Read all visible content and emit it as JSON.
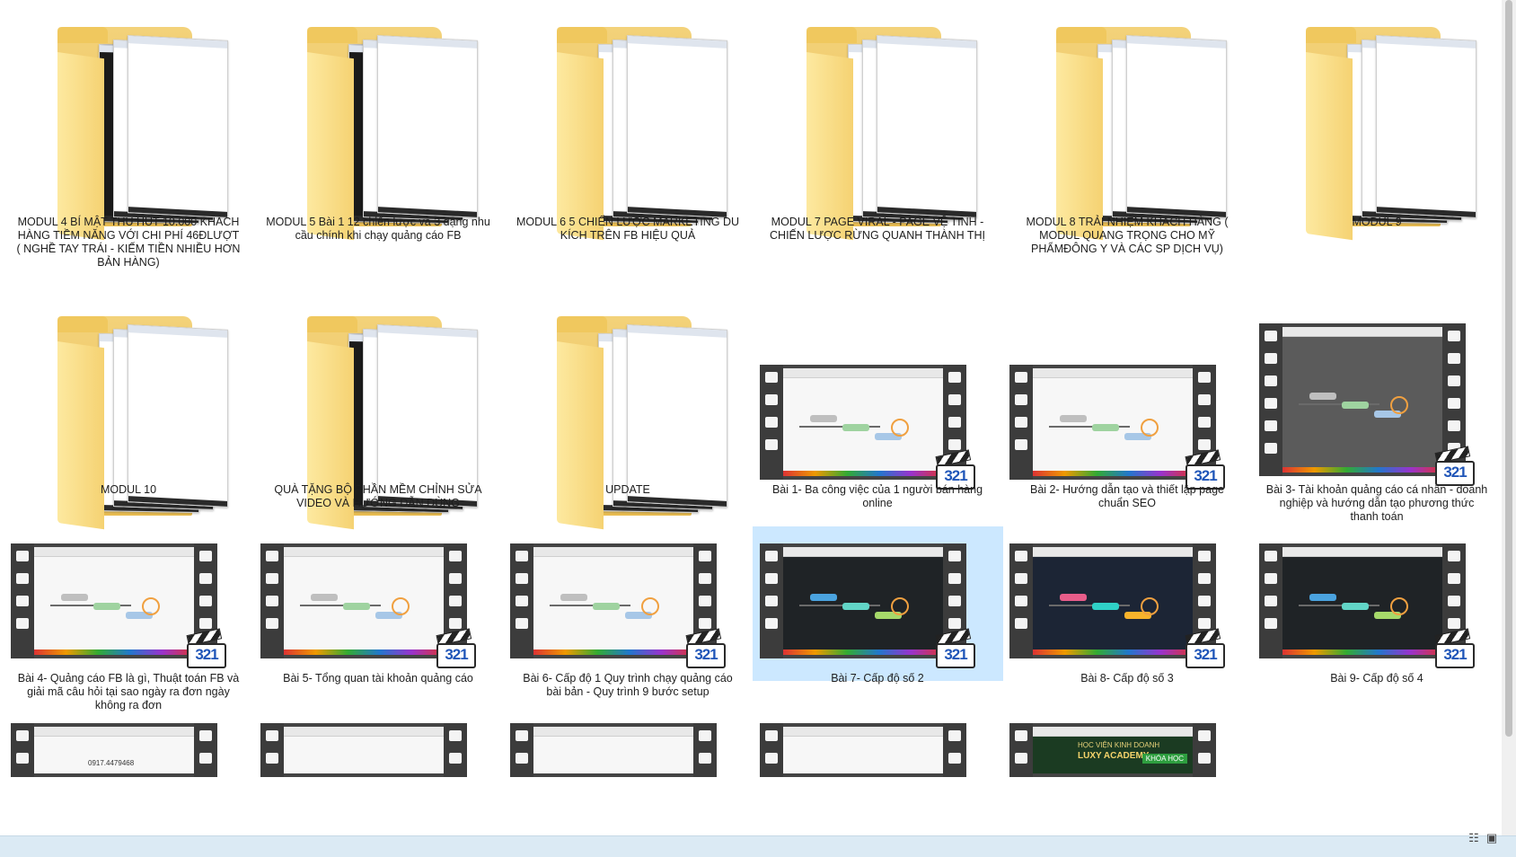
{
  "items": [
    {
      "kind": "folder",
      "label": "MODUL 4 BÍ MẬT THU HÚT 10.000 KHÁCH HÀNG TIỀM NĂNG VỚI CHI PHÍ 46ĐLƯỢT ( NGHỀ TAY TRÁI - KIẾM TIỀN NHIỀU HƠN BẢN HÀNG)",
      "style": "dark"
    },
    {
      "kind": "folder",
      "label": "MODUL 5 Bài 1 12 chiến lược và 3 dạng nhu cầu chính khi chạy quảng cáo FB",
      "style": "dark"
    },
    {
      "kind": "folder",
      "label": "MODUL 6 5 CHIẾN LƯỢC MARKETING DU KÍCH TRÊN FB HIỆU QUẢ",
      "style": "light"
    },
    {
      "kind": "folder",
      "label": "MODUL 7 PAGE VIRAL - PAGE VỆ TINH - CHIẾN LƯỢC RỪNG QUANH THÀNH THỊ",
      "style": "light"
    },
    {
      "kind": "folder",
      "label": "MODUL 8 TRẢI NHIỆM KHÁCH HÀNG ( MODUL QUANG TRỌNG CHO MỸ PHẨMĐÔNG Y VÀ CÁC SP DỊCH VỤ)",
      "style": "light"
    },
    {
      "kind": "folder",
      "label": "MODUL 9",
      "style": "light"
    },
    {
      "kind": "folder",
      "label": "MODUL 10",
      "style": "light"
    },
    {
      "kind": "folder",
      "label": "QUÀ TẶNG BỘ PHẦN MỀM CHỈNH SỬA VIDEO VÀ HƯỚNG DẪN DÙNG",
      "style": "dark"
    },
    {
      "kind": "folder",
      "label": "UPDATE",
      "style": "light"
    },
    {
      "kind": "video",
      "label": "Bài 1- Ba công việc của 1 người bán hàng online",
      "screen": "light"
    },
    {
      "kind": "video",
      "label": "Bài 2- Hướng dẫn tạo và thiết lập page chuẩn SEO",
      "screen": "light"
    },
    {
      "kind": "video",
      "label": "Bài 3- Tài khoản quảng cáo cá nhân - doanh nghiệp và hướng dẫn tạo phương thức thanh toán",
      "screen": "gray"
    },
    {
      "kind": "video",
      "label": "Bài 4- Quảng cáo FB là gì, Thuật toán FB và giải mã câu hỏi tại sao ngày ra đơn ngày không ra đơn",
      "screen": "light"
    },
    {
      "kind": "video",
      "label": "Bài 5- Tổng quan tài khoản quảng cáo",
      "screen": "light"
    },
    {
      "kind": "video",
      "label": "Bài 6- Cấp độ 1 Quy trình chạy quảng cáo bài bản - Quy trình 9 bước setup",
      "screen": "light"
    },
    {
      "kind": "video",
      "label": "Bài 7- Cấp độ số 2",
      "screen": "dark",
      "selected": true
    },
    {
      "kind": "video",
      "label": "Bài 8- Cấp độ số 3",
      "screen": "navy"
    },
    {
      "kind": "video",
      "label": "Bài 9- Cấp độ số 4",
      "screen": "dark"
    },
    {
      "kind": "video",
      "label": "",
      "screen": "light"
    },
    {
      "kind": "video",
      "label": "",
      "screen": "light"
    },
    {
      "kind": "video",
      "label": "",
      "screen": "light"
    },
    {
      "kind": "video",
      "label": "",
      "screen": "light"
    },
    {
      "kind": "video",
      "label": "",
      "screen": "banner"
    }
  ],
  "badge_text": "321",
  "partial_thumb_texts": {
    "phone_number": "0917.4479468",
    "banner_line1": "HỌC VIỆN KINH DOANH",
    "banner_line2": "LUXY ACADEMY",
    "banner_btn": "KHÓA HỌC"
  },
  "status_view_icons": [
    "details-view-icon",
    "large-icons-view-icon"
  ],
  "colors": {
    "selected": "#cce8ff",
    "folder": "#f0c85e",
    "statusbar": "#dbeaf4"
  }
}
